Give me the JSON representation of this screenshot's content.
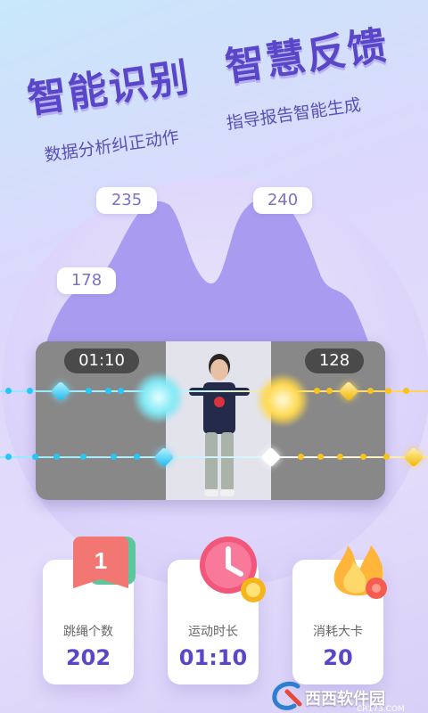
{
  "headline": {
    "left_title": "智能识别",
    "right_title": "智慧反馈",
    "left_subtitle": "数据分析纠正动作",
    "right_subtitle": "指导报告智能生成"
  },
  "wave_labels": {
    "first": "235",
    "second": "240",
    "third": "178"
  },
  "player": {
    "time": "01:10",
    "count": "128"
  },
  "stats": [
    {
      "label": "跳绳个数",
      "value": "202",
      "icon": "book-number-icon",
      "icon_text": "1"
    },
    {
      "label": "运动时长",
      "value": "01:10",
      "icon": "clock-icon"
    },
    {
      "label": "消耗大卡",
      "value": "20",
      "icon": "flame-icon"
    }
  ],
  "watermark": {
    "text": "西西软件园",
    "sub": "CR173.COM"
  },
  "colors": {
    "accent": "#5a46c8",
    "wave": "#a99cf0",
    "blue_gem": "#1cb8f0",
    "gold_gem": "#f2b400"
  }
}
